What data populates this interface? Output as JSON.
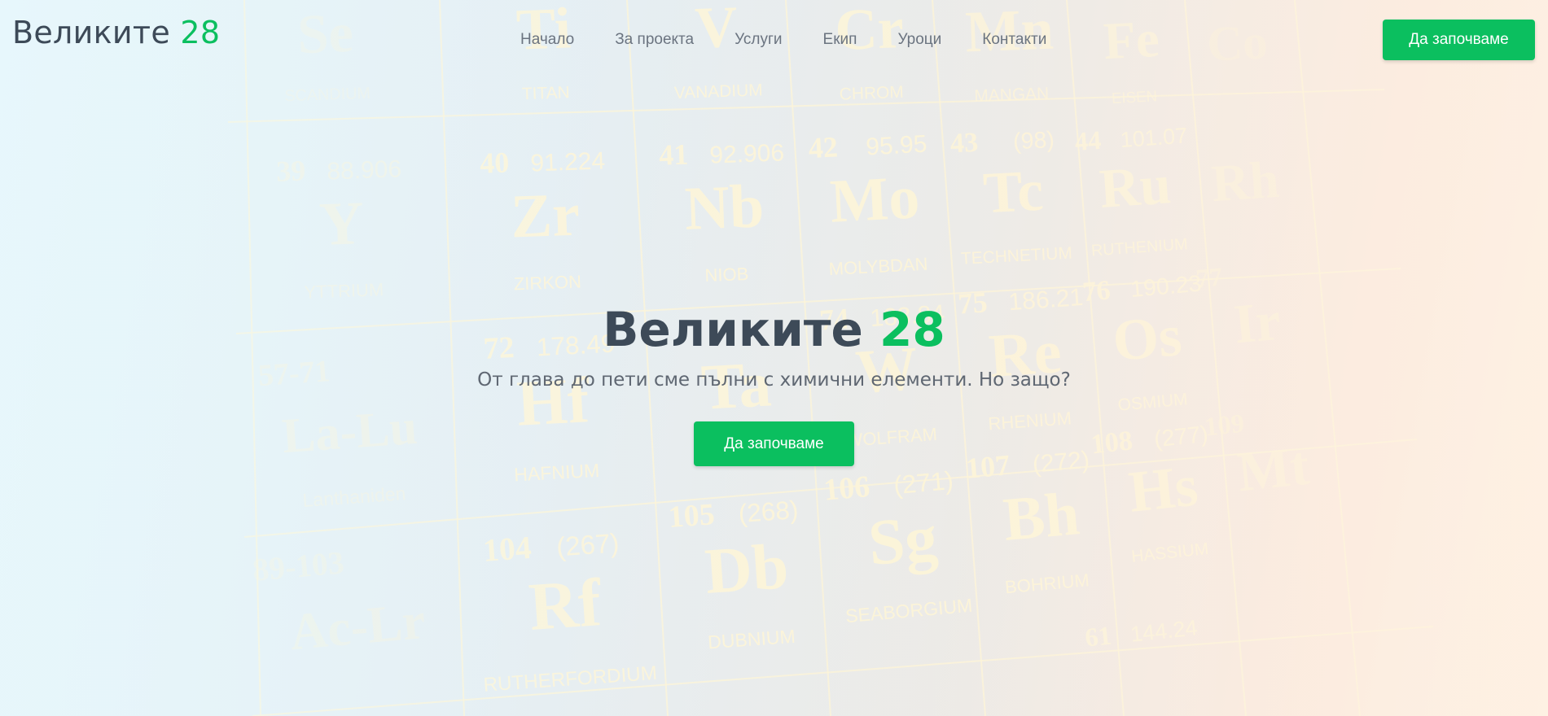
{
  "header": {
    "logo_text": "Великите",
    "logo_number": "28",
    "nav": [
      {
        "label": "Начало"
      },
      {
        "label": "За проекта"
      },
      {
        "label": "Услуги"
      },
      {
        "label": "Екип"
      },
      {
        "label": "Уроци"
      },
      {
        "label": "Контакти"
      }
    ],
    "cta_label": "Да започваме"
  },
  "hero": {
    "title_text": "Великите",
    "title_number": "28",
    "subtitle": "От глава до пети сме пълни с химични елементи. Но защо?",
    "cta_label": "Да започваме"
  },
  "background": {
    "elements": [
      {
        "symbol": "Se",
        "name": "SCANDIUM",
        "number": "",
        "mass": ""
      },
      {
        "symbol": "Ti",
        "name": "TITAN",
        "number": "",
        "mass": ""
      },
      {
        "symbol": "V",
        "name": "VANADIUM",
        "number": "",
        "mass": ""
      },
      {
        "symbol": "Cr",
        "name": "CHROM",
        "number": "",
        "mass": ""
      },
      {
        "symbol": "Mn",
        "name": "MANGAN",
        "number": "",
        "mass": ""
      },
      {
        "symbol": "Fe",
        "name": "EISEN",
        "number": "",
        "mass": ""
      },
      {
        "symbol": "Co",
        "name": "",
        "number": "",
        "mass": ""
      },
      {
        "symbol": "Y",
        "name": "YTTRIUM",
        "number": "39",
        "mass": "88.906"
      },
      {
        "symbol": "Zr",
        "name": "ZIRKON",
        "number": "40",
        "mass": "91.224"
      },
      {
        "symbol": "Nb",
        "name": "NIOB",
        "number": "41",
        "mass": "92.906"
      },
      {
        "symbol": "Mo",
        "name": "MOLYBDAN",
        "number": "42",
        "mass": "95.95"
      },
      {
        "symbol": "Tc",
        "name": "TECHNETIUM",
        "number": "43",
        "mass": "(98)"
      },
      {
        "symbol": "Ru",
        "name": "RUTHENIUM",
        "number": "44",
        "mass": "101.07"
      },
      {
        "symbol": "Rh",
        "name": "",
        "number": "",
        "mass": ""
      },
      {
        "symbol": "La-Lu",
        "name": "Lanthaniden",
        "number": "57-71",
        "mass": ""
      },
      {
        "symbol": "Hf",
        "name": "HAFNIUM",
        "number": "72",
        "mass": "178.49"
      },
      {
        "symbol": "Ta",
        "name": "",
        "number": "",
        "mass": ""
      },
      {
        "symbol": "W",
        "name": "WOLFRAM",
        "number": "74",
        "mass": "183.84"
      },
      {
        "symbol": "Re",
        "name": "RHENIUM",
        "number": "75",
        "mass": "186.21"
      },
      {
        "symbol": "Os",
        "name": "OSMIUM",
        "number": "76",
        "mass": "190.23"
      },
      {
        "symbol": "Ir",
        "name": "",
        "number": "77",
        "mass": ""
      },
      {
        "symbol": "Ac-Lr",
        "name": "",
        "number": "89-103",
        "mass": ""
      },
      {
        "symbol": "Rf",
        "name": "RUTHERFORDIUM",
        "number": "104",
        "mass": "(267)"
      },
      {
        "symbol": "Db",
        "name": "DUBNIUM",
        "number": "105",
        "mass": "(268)"
      },
      {
        "symbol": "Sg",
        "name": "SEABORGIUM",
        "number": "106",
        "mass": "(271)"
      },
      {
        "symbol": "Bh",
        "name": "BOHRIUM",
        "number": "107",
        "mass": "(272)"
      },
      {
        "symbol": "Hs",
        "name": "HASSIUM",
        "number": "108",
        "mass": "(277)"
      },
      {
        "symbol": "Mt",
        "name": "",
        "number": "109",
        "mass": ""
      },
      {
        "symbol": "",
        "name": "",
        "number": "61",
        "mass": "144.24"
      }
    ]
  },
  "colors": {
    "accent": "#0bbf5f",
    "text_dark": "#3d4a58",
    "nav_text": "#6b7480",
    "element_glyph": "#fff6d6"
  }
}
